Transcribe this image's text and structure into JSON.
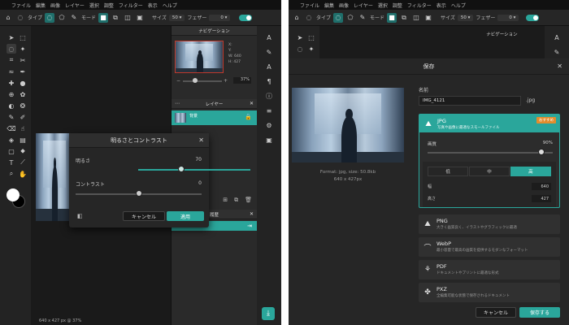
{
  "left": {
    "menu": [
      "ファイル",
      "編集",
      "画像",
      "レイヤー",
      "選択",
      "調整",
      "フィルター",
      "表示",
      "ヘルプ"
    ],
    "toolbar": {
      "type_label": "タイプ",
      "mode_label": "モード",
      "size_label": "サイズ",
      "size_value": "50",
      "feather_label": "フェザー",
      "feather_value": "0"
    },
    "navigation": {
      "title": "ナビゲーション",
      "x_label": "X:",
      "y_label": "Y:",
      "w_label": "W:",
      "w_value": "640",
      "h_label": "H:",
      "h_value": "427",
      "zoom": "37%"
    },
    "layers": {
      "title": "レイヤー",
      "item_name": "背景"
    },
    "history": {
      "title": "履歴"
    },
    "status": "640 x 427 px @ 37%",
    "dialog": {
      "title": "明るさとコントラスト",
      "brightness_label": "明るさ",
      "brightness_value": "70",
      "contrast_label": "コントラスト",
      "contrast_value": "0",
      "cancel": "キャンセル",
      "apply": "適用"
    }
  },
  "right": {
    "menu": [
      "ファイル",
      "編集",
      "画像",
      "レイヤー",
      "選択",
      "調整",
      "フィルター",
      "表示",
      "ヘルプ"
    ],
    "toolbar": {
      "type_label": "タイプ",
      "mode_label": "モード",
      "size_label": "サイズ",
      "size_value": "50",
      "feather_label": "フェザー",
      "feather_value": "0"
    },
    "navigation_title": "ナビゲーション",
    "save": {
      "title": "保存",
      "name_label": "名前",
      "name_value": "IMG_4121",
      "extension": ".jpg",
      "preview_format": "Format: jpg, size: 50.8kb",
      "preview_dims": "640 x 427px",
      "jpg": {
        "name": "JPG",
        "desc": "写真や画像に最適なスモールファイル",
        "badge": "おすすめ"
      },
      "quality_label": "画質",
      "quality_value": "90%",
      "quality_fraction": 0.9,
      "quality_levels": [
        "低",
        "中",
        "高"
      ],
      "width_label": "幅",
      "width_value": "640",
      "height_label": "高さ",
      "height_value": "427",
      "png": {
        "name": "PNG",
        "desc": "大きく画質良く、イラストやグラフィックに最適"
      },
      "webp": {
        "name": "WebP",
        "desc": "最小容量で最高の画質を提供するモダンなフォーマット"
      },
      "pdf": {
        "name": "PDF",
        "desc": "ドキュメントやプリントに最適な形式"
      },
      "pxz": {
        "name": "PXZ",
        "desc": "全編集可能な状態で保存されるドキュメント"
      },
      "cancel": "キャンセル",
      "save_button": "保存する"
    }
  },
  "colors": {
    "accent": "#2aa69b",
    "panel": "#262626",
    "bg": "#1b1b1b"
  }
}
